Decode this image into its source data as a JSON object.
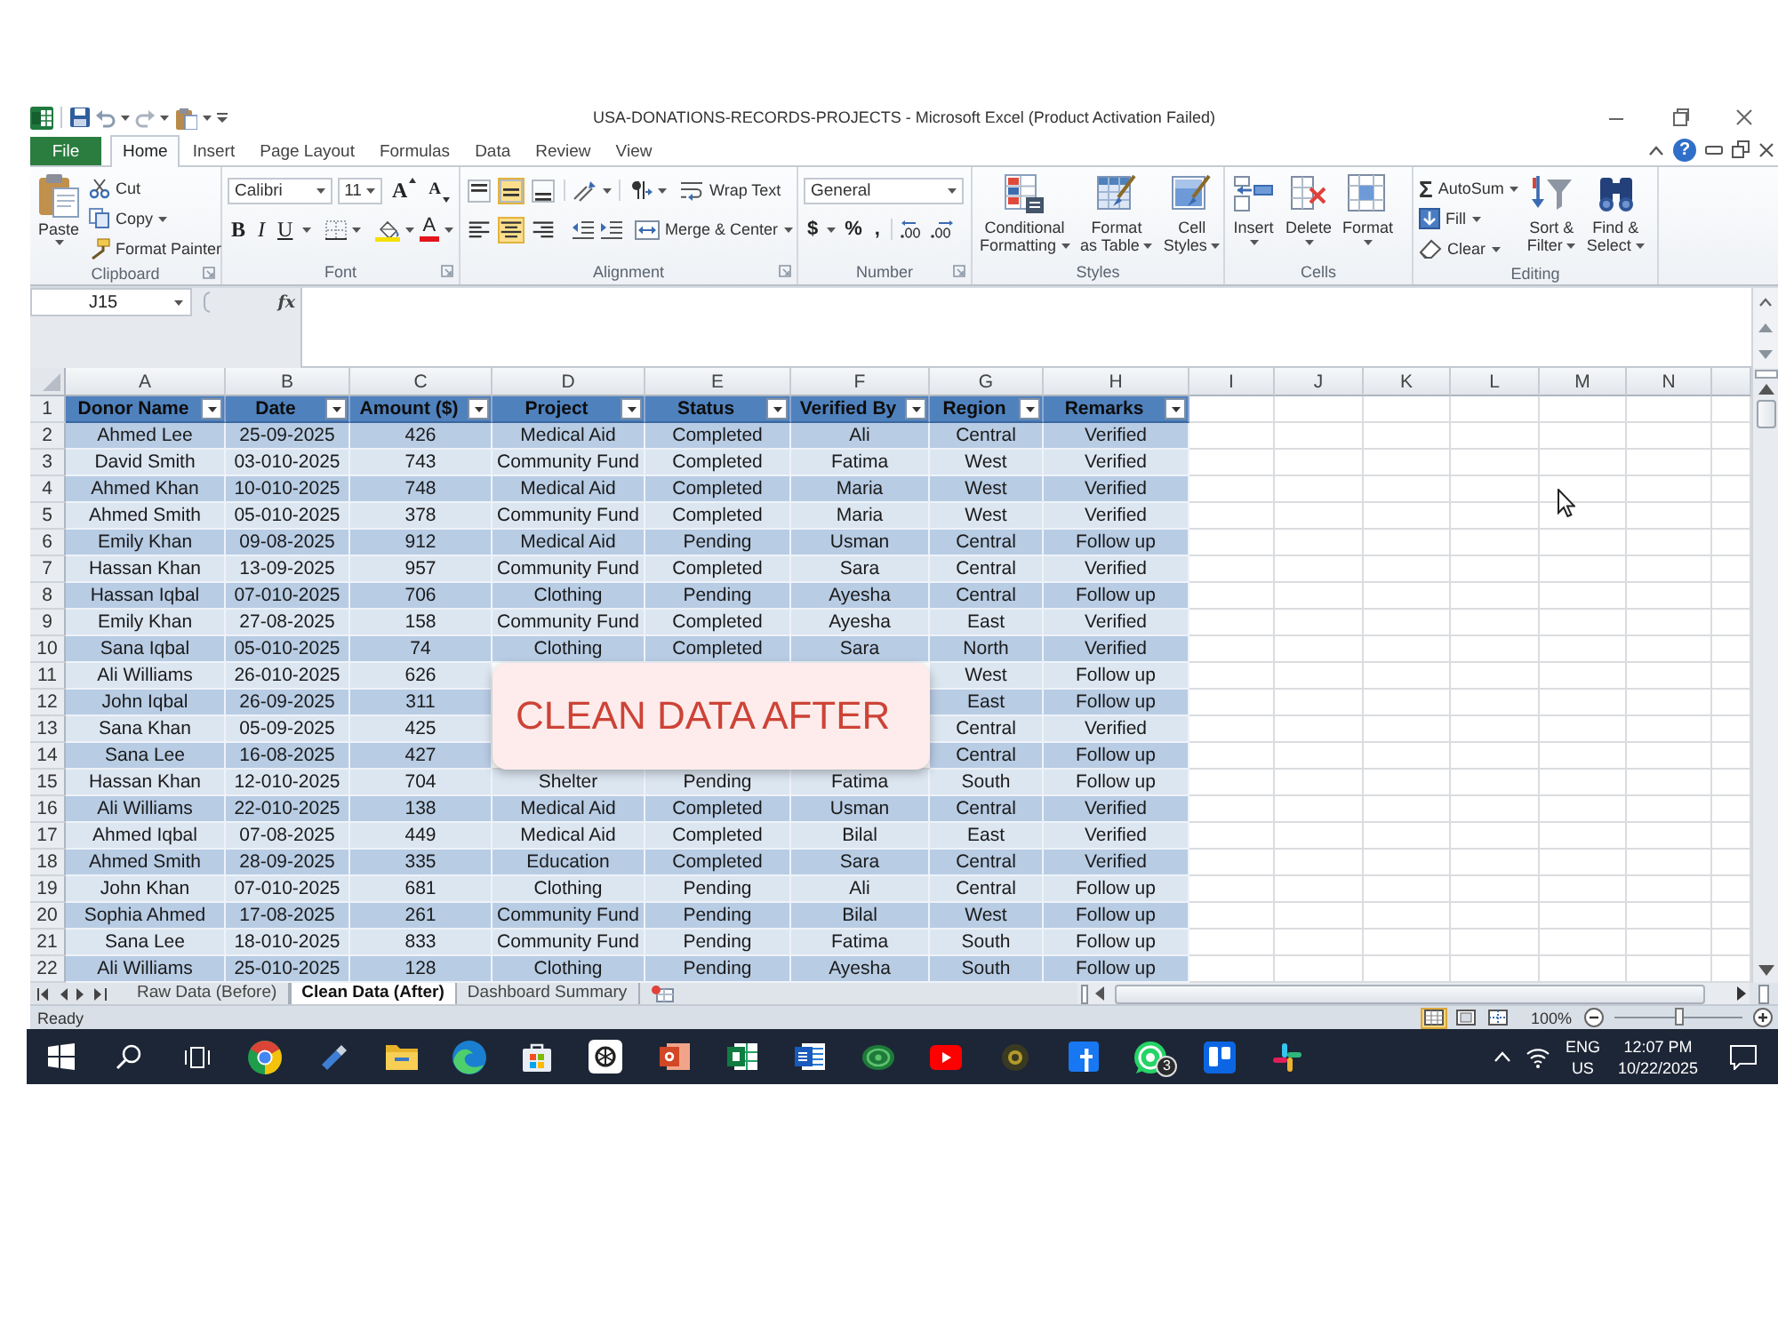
{
  "window": {
    "title": "USA-DONATIONS-RECORDS-PROJECTS - Microsoft Excel (Product Activation Failed)",
    "help": "?"
  },
  "ribbon_tabs": [
    {
      "label": "File",
      "kind": "file",
      "selected": false
    },
    {
      "label": "Home",
      "kind": "tab",
      "selected": true
    },
    {
      "label": "Insert",
      "kind": "tab",
      "selected": false
    },
    {
      "label": "Page Layout",
      "kind": "tab",
      "selected": false
    },
    {
      "label": "Formulas",
      "kind": "tab",
      "selected": false
    },
    {
      "label": "Data",
      "kind": "tab",
      "selected": false
    },
    {
      "label": "Review",
      "kind": "tab",
      "selected": false
    },
    {
      "label": "View",
      "kind": "tab",
      "selected": false
    }
  ],
  "ribbon": {
    "clipboard": {
      "label": "Clipboard",
      "paste": "Paste",
      "cut": "Cut",
      "copy": "Copy",
      "format_painter": "Format Painter"
    },
    "font": {
      "label": "Font",
      "name": "Calibri",
      "size": "11",
      "grow": "A",
      "shrink": "A",
      "bold": "B",
      "italic": "I",
      "underline": "U",
      "text_tint": "A"
    },
    "alignment": {
      "label": "Alignment",
      "vertical": [
        {
          "on": false
        },
        {
          "on": true
        },
        {
          "on": false
        }
      ],
      "horizontal": [
        {
          "on": false
        },
        {
          "on": true
        },
        {
          "on": false
        }
      ],
      "wrap_text": "Wrap Text",
      "merge": "Merge & Center"
    },
    "number": {
      "label": "Number",
      "format": "General",
      "currency": "$",
      "percent": "%",
      "comma": ","
    },
    "styles": {
      "label": "Styles",
      "buttons": [
        "Conditional\nFormatting",
        "Format\nas Table",
        "Cell\nStyles"
      ]
    },
    "cells": {
      "label": "Cells",
      "buttons": [
        "Insert",
        "Delete",
        "Format"
      ]
    },
    "editing": {
      "label": "Editing",
      "sigma": "Σ",
      "autosum": "AutoSum",
      "fill": "Fill",
      "clear": "Clear",
      "sort": "Sort &\nFilter",
      "find": "Find &\nSelect"
    }
  },
  "formula_bar": {
    "name_box": "J15",
    "function": "fx"
  },
  "sheet": {
    "columns": [
      "A",
      "B",
      "C",
      "D",
      "E",
      "F",
      "G",
      "H",
      "I",
      "J",
      "K",
      "L",
      "M",
      "N"
    ],
    "row_numbers": [
      "1",
      "2",
      "3",
      "4",
      "5",
      "6",
      "7",
      "8",
      "9",
      "10",
      "11",
      "12",
      "13",
      "14",
      "15",
      "16",
      "17",
      "18",
      "19",
      "20",
      "21",
      "22"
    ],
    "table": {
      "headers": [
        "Donor Name",
        "Date",
        "Amount ($)",
        "Project",
        "Status",
        "Verified By",
        "Region",
        "Remarks"
      ],
      "rows": [
        [
          "Ahmed Lee",
          "25-09-2025",
          "426",
          "Medical Aid",
          "Completed",
          "Ali",
          "Central",
          "Verified"
        ],
        [
          "David Smith",
          "03-010-2025",
          "743",
          "Community Fund",
          "Completed",
          "Fatima",
          "West",
          "Verified"
        ],
        [
          "Ahmed Khan",
          "10-010-2025",
          "748",
          "Medical Aid",
          "Completed",
          "Maria",
          "West",
          "Verified"
        ],
        [
          "Ahmed Smith",
          "05-010-2025",
          "378",
          "Community Fund",
          "Completed",
          "Maria",
          "West",
          "Verified"
        ],
        [
          "Emily Khan",
          "09-08-2025",
          "912",
          "Medical Aid",
          "Pending",
          "Usman",
          "Central",
          "Follow up"
        ],
        [
          "Hassan Khan",
          "13-09-2025",
          "957",
          "Community Fund",
          "Completed",
          "Sara",
          "Central",
          "Verified"
        ],
        [
          "Hassan Iqbal",
          "07-010-2025",
          "706",
          "Clothing",
          "Pending",
          "Ayesha",
          "Central",
          "Follow up"
        ],
        [
          "Emily Khan",
          "27-08-2025",
          "158",
          "Community Fund",
          "Completed",
          "Ayesha",
          "East",
          "Verified"
        ],
        [
          "Sana Iqbal",
          "05-010-2025",
          "74",
          "Clothing",
          "Completed",
          "Sara",
          "North",
          "Verified"
        ],
        [
          "Ali Williams",
          "26-010-2025",
          "626",
          null,
          null,
          null,
          "West",
          "Follow up"
        ],
        [
          "John Iqbal",
          "26-09-2025",
          "311",
          null,
          null,
          null,
          "East",
          "Follow up"
        ],
        [
          "Sana Khan",
          "05-09-2025",
          "425",
          null,
          null,
          null,
          "Central",
          "Verified"
        ],
        [
          "Sana Lee",
          "16-08-2025",
          "427",
          null,
          null,
          null,
          "Central",
          "Follow up"
        ],
        [
          "Hassan Khan",
          "12-010-2025",
          "704",
          "Shelter",
          "Pending",
          "Fatima",
          "South",
          "Follow up"
        ],
        [
          "Ali Williams",
          "22-010-2025",
          "138",
          "Medical Aid",
          "Completed",
          "Usman",
          "Central",
          "Verified"
        ],
        [
          "Ahmed Iqbal",
          "07-08-2025",
          "449",
          "Medical Aid",
          "Completed",
          "Bilal",
          "East",
          "Verified"
        ],
        [
          "Ahmed Smith",
          "28-09-2025",
          "335",
          "Education",
          "Completed",
          "Sara",
          "Central",
          "Verified"
        ],
        [
          "John Khan",
          "07-010-2025",
          "681",
          "Clothing",
          "Pending",
          "Ali",
          "Central",
          "Follow up"
        ],
        [
          "Sophia Ahmed",
          "17-08-2025",
          "261",
          "Community Fund",
          "Pending",
          "Bilal",
          "West",
          "Follow up"
        ],
        [
          "Sana Lee",
          "18-010-2025",
          "833",
          "Community Fund",
          "Pending",
          "Fatima",
          "South",
          "Follow up"
        ],
        [
          "Ali Williams",
          "25-010-2025",
          "128",
          "Clothing",
          "Pending",
          "Ayesha",
          "South",
          "Follow up"
        ]
      ]
    },
    "overlay": "CLEAN DATA AFTER"
  },
  "sheet_tabs": [
    {
      "label": "Raw Data (Before)",
      "selected": false
    },
    {
      "label": "Clean Data (After)",
      "selected": true
    },
    {
      "label": "Dashboard Summary",
      "selected": false
    }
  ],
  "status_bar": {
    "status": "Ready",
    "views": [
      {
        "selected": true
      },
      {
        "selected": false
      },
      {
        "selected": false
      }
    ],
    "zoom": {
      "reading": "100%",
      "level": 0.5
    }
  },
  "taskbar": {
    "badge": "3",
    "language": "ENG",
    "region": "US",
    "time": "12:07 PM",
    "date": "10/22/2025"
  }
}
